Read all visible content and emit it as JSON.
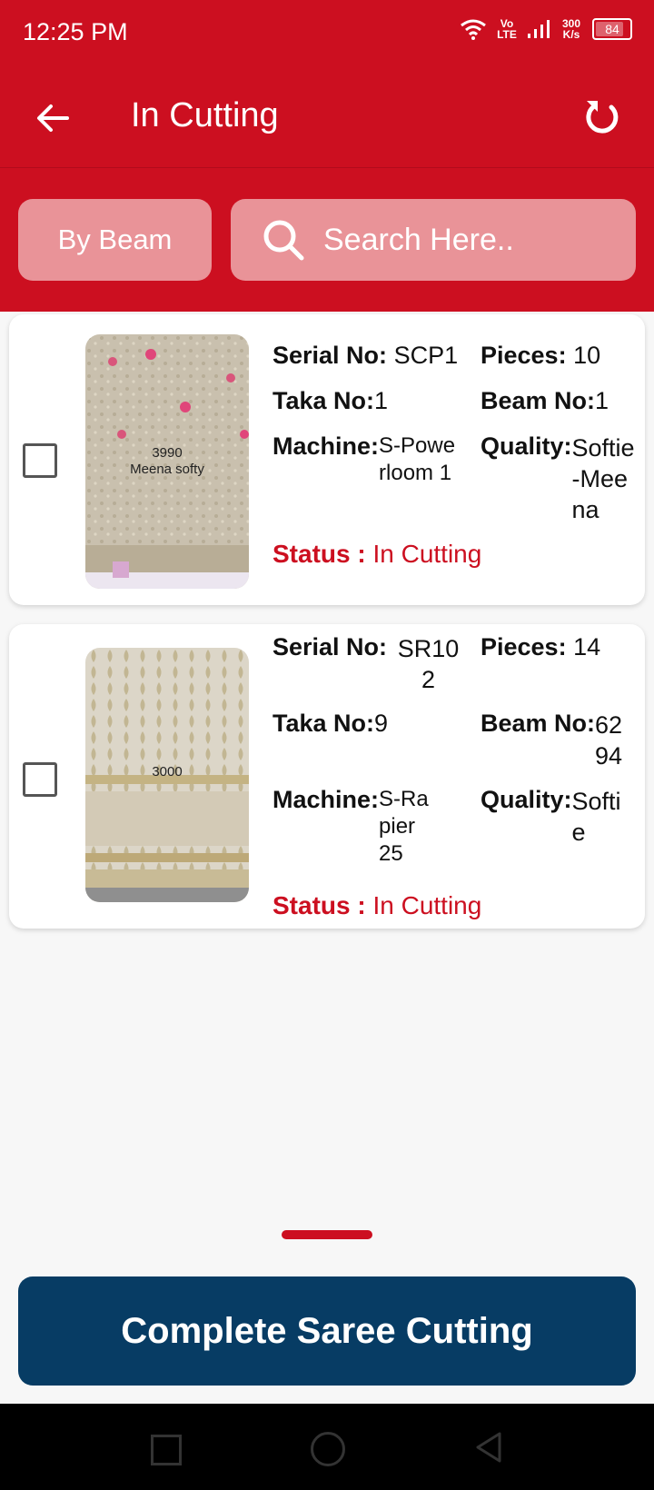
{
  "status_bar": {
    "time": "12:25 PM",
    "network": "Vo LTE",
    "speed": "300 K/s",
    "battery": "84"
  },
  "app_bar": {
    "title": "In Cutting"
  },
  "filters": {
    "by_beam_label": "By Beam",
    "search_placeholder": "Search Here.."
  },
  "labels": {
    "serial_no": "Serial No:",
    "pieces": "Pieces:",
    "taka_no": "Taka No:",
    "beam_no": "Beam No:",
    "machine": "Machine:",
    "quality": "Quality:",
    "status": "Status :"
  },
  "items": [
    {
      "serial_no": "SCP1",
      "pieces": "10",
      "taka_no": "1",
      "beam_no": "1",
      "machine": "S-Powerloom 1",
      "quality": "Softie-Meena",
      "status": "In Cutting",
      "image_text": [
        "3990",
        "Meena softy"
      ]
    },
    {
      "serial_no": "SR102",
      "pieces": "14",
      "taka_no": "9",
      "beam_no": "6294",
      "machine": "S-Rapier 25",
      "quality": "Softie",
      "status": "In Cutting",
      "image_text": [
        "3000"
      ]
    }
  ],
  "footer": {
    "complete_label": "Complete Saree Cutting"
  },
  "colors": {
    "primary_red": "#cc0f20",
    "button_navy": "#073c64"
  }
}
